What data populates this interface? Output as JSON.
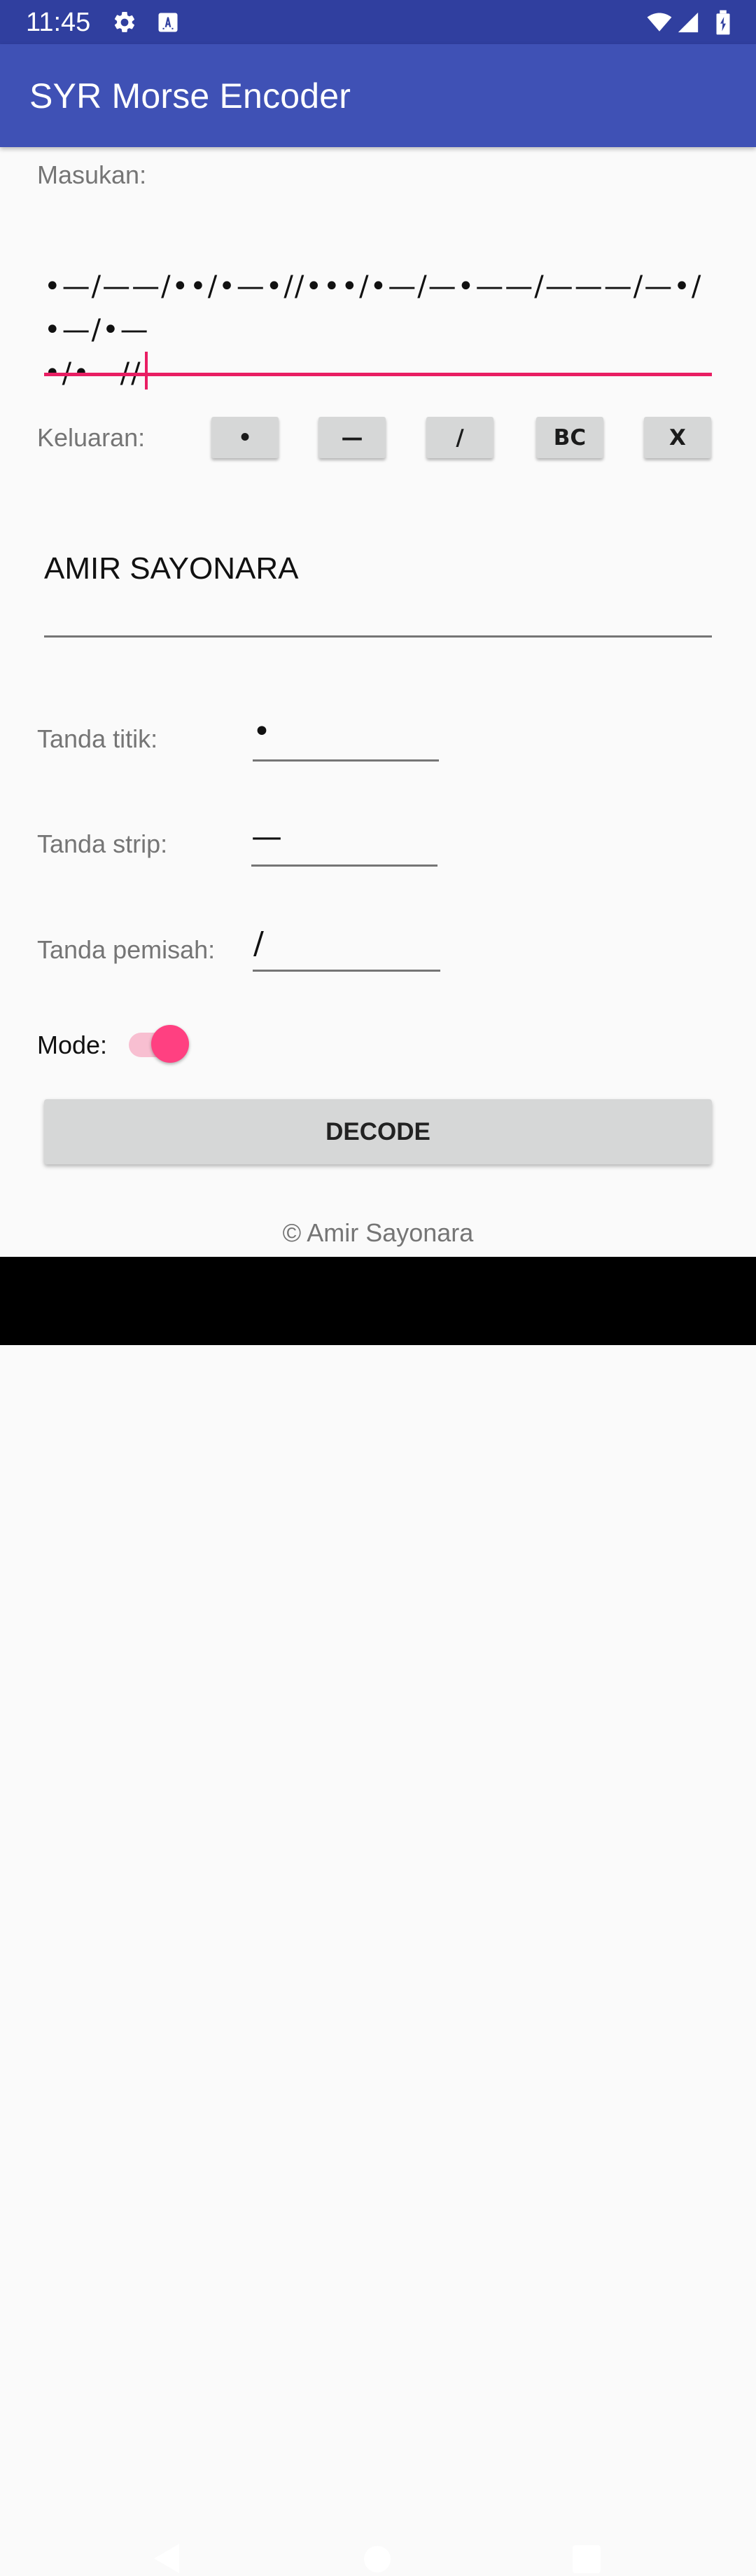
{
  "status_bar": {
    "time": "11:45",
    "left_icons": [
      "gear-icon",
      "a-box-icon"
    ],
    "right_icons": [
      "wifi-icon",
      "signal-icon",
      "battery-icon"
    ]
  },
  "app_bar": {
    "title": "SYR Morse Encoder"
  },
  "input_section": {
    "label": "Masukan:",
    "line1": "•—/——/••/•—•//•••/•—/—•——/———/—•/•—/•—",
    "line2": "•/•—//"
  },
  "output_section": {
    "label": "Keluaran:",
    "buttons": [
      {
        "label": "•",
        "name": "dot-button"
      },
      {
        "label": "—",
        "name": "dash-button"
      },
      {
        "label": "/",
        "name": "slash-button"
      },
      {
        "label": "BC",
        "name": "backspace-button"
      },
      {
        "label": "X",
        "name": "clear-button"
      }
    ],
    "value": "AMIR SAYONARA"
  },
  "settings": {
    "dot_label": "Tanda titik:",
    "dot_value": "•",
    "dash_label": "Tanda strip:",
    "dash_value": "—",
    "separator_label": "Tanda pemisah:",
    "separator_value": "/"
  },
  "mode": {
    "label": "Mode:",
    "enabled": true,
    "accent_color": "#ff4081"
  },
  "actions": {
    "decode_label": "DECODE"
  },
  "footer": {
    "copyright": "© Amir Sayonara"
  },
  "navigation": {
    "icons": [
      "back-icon",
      "home-icon",
      "recents-icon"
    ]
  },
  "colors": {
    "status_bar": "#303f9f",
    "app_bar": "#3f51b5",
    "accent": "#e91e63",
    "background": "#fafafa"
  }
}
